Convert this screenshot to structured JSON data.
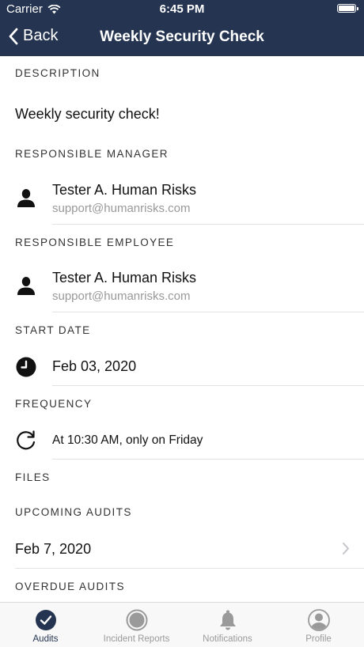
{
  "status_bar": {
    "carrier": "Carrier",
    "time": "6:45 PM"
  },
  "nav": {
    "back_label": "Back",
    "title": "Weekly Security Check"
  },
  "description": {
    "header": "DESCRIPTION",
    "text": "Weekly security check!"
  },
  "responsible_manager": {
    "header": "RESPONSIBLE MANAGER",
    "name": "Tester A. Human Risks",
    "email": "support@humanrisks.com"
  },
  "responsible_employee": {
    "header": "RESPONSIBLE EMPLOYEE",
    "name": "Tester A. Human Risks",
    "email": "support@humanrisks.com"
  },
  "start_date": {
    "header": "START DATE",
    "value": "Feb 03, 2020"
  },
  "frequency": {
    "header": "FREQUENCY",
    "value": "At 10:30 AM, only on Friday"
  },
  "files": {
    "header": "FILES"
  },
  "upcoming_audits": {
    "header": "UPCOMING AUDITS",
    "items": [
      {
        "date": "Feb 7, 2020"
      }
    ]
  },
  "overdue_audits": {
    "header": "OVERDUE AUDITS"
  },
  "tabs": [
    {
      "label": "Audits",
      "icon": "checkmark-circle-icon",
      "active": true
    },
    {
      "label": "Incident Reports",
      "icon": "circle-record-icon",
      "active": false
    },
    {
      "label": "Notifications",
      "icon": "bell-icon",
      "active": false
    },
    {
      "label": "Profile",
      "icon": "user-circle-icon",
      "active": false
    }
  ],
  "colors": {
    "nav_background": "#253551",
    "active_tab": "#253551",
    "inactive_tab": "#9a9a9a",
    "secondary_text": "#999999"
  }
}
